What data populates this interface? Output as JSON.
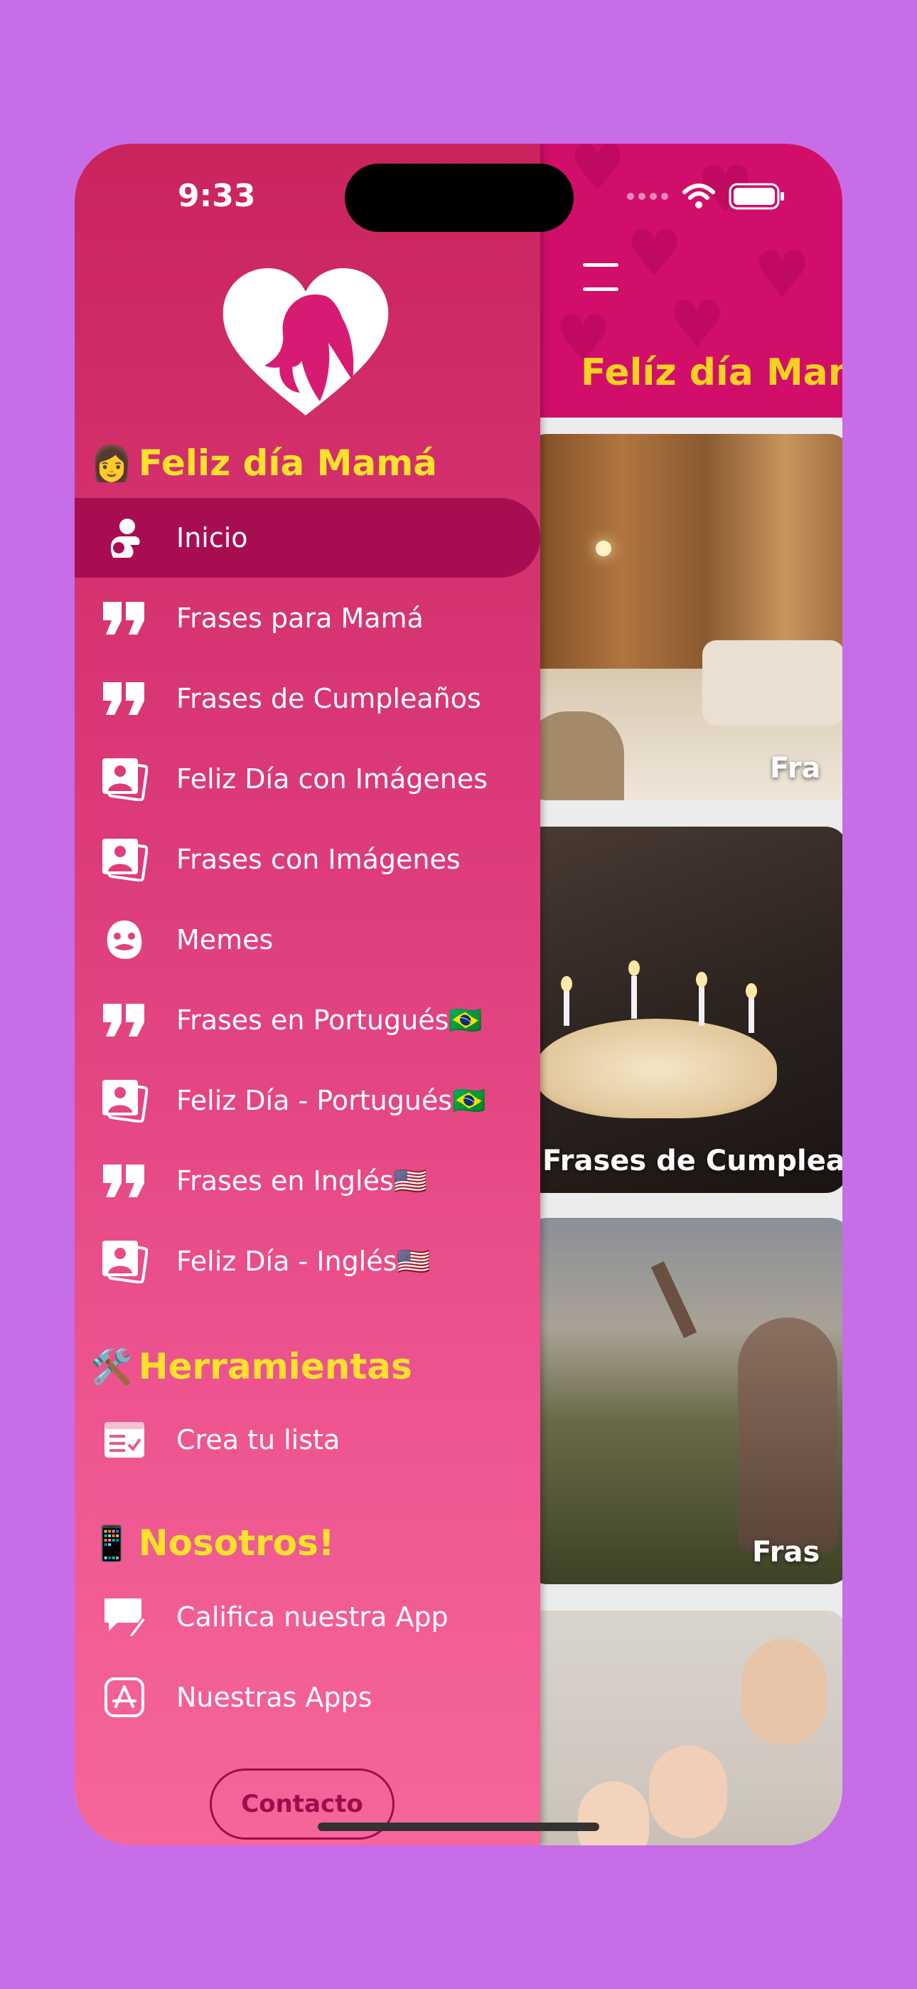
{
  "status_bar": {
    "time": "9:33"
  },
  "main": {
    "title": "Felíz día Mam",
    "cards": [
      {
        "label": "Fra"
      },
      {
        "label": "Frases de Cumplea"
      },
      {
        "label": "Fras"
      },
      {
        "label": ""
      }
    ]
  },
  "drawer": {
    "app_section": {
      "emoji": "👩",
      "title": "Feliz día Mamá"
    },
    "items": [
      {
        "label": "Inicio",
        "icon": "mother-child-icon"
      },
      {
        "label": "Frases para Mamá",
        "icon": "quote-icon"
      },
      {
        "label": "Frases de Cumpleaños",
        "icon": "quote-icon"
      },
      {
        "label": "Feliz Día con Imágenes",
        "icon": "photos-icon"
      },
      {
        "label": "Frases con Imágenes",
        "icon": "photos-icon"
      },
      {
        "label": "Memes",
        "icon": "meme-face-icon"
      },
      {
        "label": "Frases en Portugués🇧🇷",
        "icon": "quote-icon"
      },
      {
        "label": "Feliz Día - Portugués🇧🇷",
        "icon": "photos-icon"
      },
      {
        "label": "Frases en Inglés🇺🇸",
        "icon": "quote-icon"
      },
      {
        "label": "Feliz Día - Inglés🇺🇸",
        "icon": "photos-icon"
      }
    ],
    "tools_section": {
      "emoji": "🛠️",
      "title": "Herramientas"
    },
    "tools_items": [
      {
        "label": "Crea tu lista",
        "icon": "checklist-icon"
      }
    ],
    "about_section": {
      "emoji": "📱",
      "title": "Nosotros!"
    },
    "about_items": [
      {
        "label": "Califica nuestra App",
        "icon": "rate-comment-icon"
      },
      {
        "label": "Nuestras Apps",
        "icon": "app-store-icon"
      }
    ],
    "contact_label": "Contacto"
  },
  "colors": {
    "drawer_top": "#c9245e",
    "drawer_bottom": "#f5669a",
    "active_item": "#a90d51",
    "section_title": "#fce22b",
    "header_bg": "#d10f6b",
    "title_yellow": "#f5d21f",
    "page_bg": "#c76de8"
  }
}
